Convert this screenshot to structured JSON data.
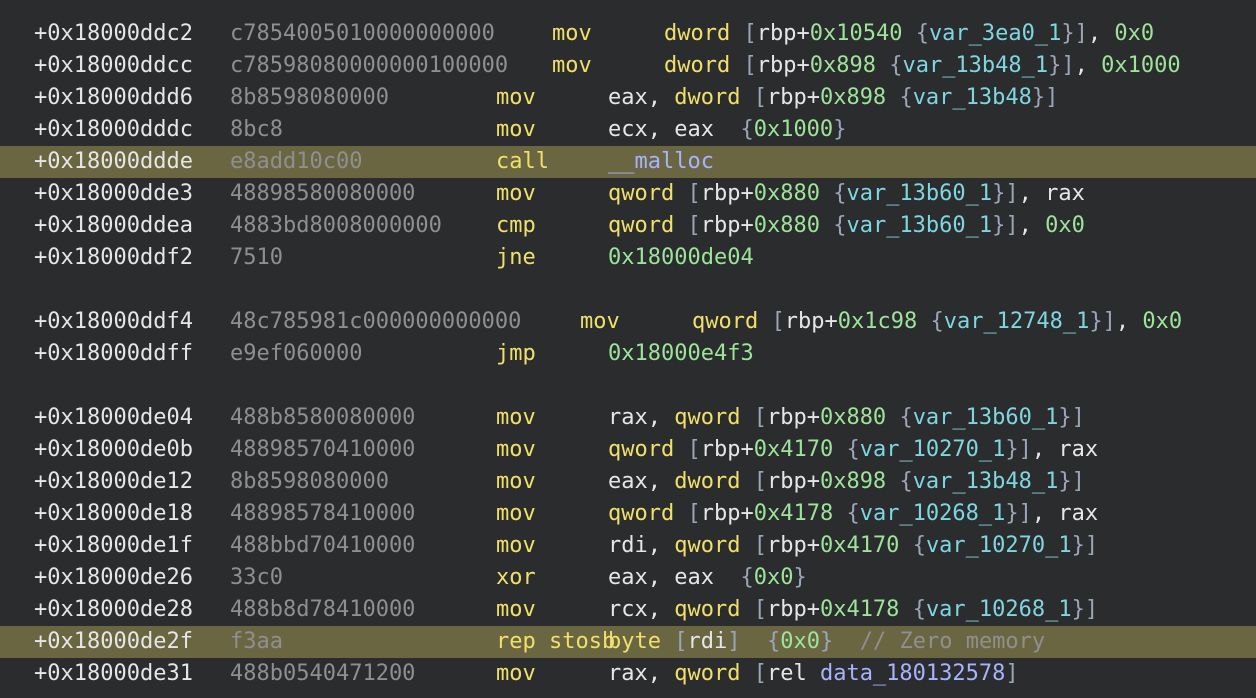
{
  "listing": {
    "rows": [
      {
        "addr": "+0x18000ddc2",
        "bytes": "c7854005010000000000",
        "mn": "mov",
        "ops": [
          [
            "kw",
            "dword "
          ],
          [
            "br",
            "["
          ],
          [
            "t",
            "rbp+"
          ],
          [
            "num",
            "0x10540"
          ],
          [
            "t",
            " "
          ],
          [
            "br",
            "{"
          ],
          [
            "var",
            "var_3ea0_1"
          ],
          [
            "br",
            "}"
          ],
          [
            "br",
            "]"
          ],
          [
            "t",
            ", "
          ],
          [
            "num",
            "0x0"
          ]
        ],
        "hl": false,
        "layout": "a"
      },
      {
        "addr": "+0x18000ddcc",
        "bytes": "c78598080000000100000",
        "mn": "mov",
        "ops": [
          [
            "kw",
            "dword "
          ],
          [
            "br",
            "["
          ],
          [
            "t",
            "rbp+"
          ],
          [
            "num",
            "0x898"
          ],
          [
            "t",
            " "
          ],
          [
            "br",
            "{"
          ],
          [
            "var",
            "var_13b48_1"
          ],
          [
            "br",
            "}"
          ],
          [
            "br",
            "]"
          ],
          [
            "t",
            ", "
          ],
          [
            "num",
            "0x1000"
          ]
        ],
        "hl": false,
        "layout": "a"
      },
      {
        "addr": "+0x18000ddd6",
        "bytes": "8b8598080000",
        "mn": "mov",
        "ops": [
          [
            "t",
            "eax, "
          ],
          [
            "kw",
            "dword "
          ],
          [
            "br",
            "["
          ],
          [
            "t",
            "rbp+"
          ],
          [
            "num",
            "0x898"
          ],
          [
            "t",
            " "
          ],
          [
            "br",
            "{"
          ],
          [
            "var",
            "var_13b48"
          ],
          [
            "br",
            "}"
          ],
          [
            "br",
            "]"
          ]
        ],
        "hl": false,
        "layout": "b"
      },
      {
        "addr": "+0x18000dddc",
        "bytes": "8bc8",
        "mn": "mov",
        "ops": [
          [
            "t",
            "ecx, eax  "
          ],
          [
            "br",
            "{"
          ],
          [
            "num",
            "0x1000"
          ],
          [
            "br",
            "}"
          ]
        ],
        "hl": false,
        "layout": "b"
      },
      {
        "addr": "+0x18000ddde",
        "bytes": "e8add10c00",
        "mn": "call",
        "ops": [
          [
            "sym",
            "__malloc"
          ]
        ],
        "hl": true,
        "layout": "b"
      },
      {
        "addr": "+0x18000dde3",
        "bytes": "48898580080000",
        "mn": "mov",
        "ops": [
          [
            "kw",
            "qword "
          ],
          [
            "br",
            "["
          ],
          [
            "t",
            "rbp+"
          ],
          [
            "num",
            "0x880"
          ],
          [
            "t",
            " "
          ],
          [
            "br",
            "{"
          ],
          [
            "var",
            "var_13b60_1"
          ],
          [
            "br",
            "}"
          ],
          [
            "br",
            "]"
          ],
          [
            "t",
            ", rax"
          ]
        ],
        "hl": false,
        "layout": "b"
      },
      {
        "addr": "+0x18000ddea",
        "bytes": "4883bd8008000000",
        "mn": "cmp",
        "ops": [
          [
            "kw",
            "qword "
          ],
          [
            "br",
            "["
          ],
          [
            "t",
            "rbp+"
          ],
          [
            "num",
            "0x880"
          ],
          [
            "t",
            " "
          ],
          [
            "br",
            "{"
          ],
          [
            "var",
            "var_13b60_1"
          ],
          [
            "br",
            "}"
          ],
          [
            "br",
            "]"
          ],
          [
            "t",
            ", "
          ],
          [
            "num",
            "0x0"
          ]
        ],
        "hl": false,
        "layout": "b"
      },
      {
        "addr": "+0x18000ddf2",
        "bytes": "7510",
        "mn": "jne",
        "ops": [
          [
            "num",
            "0x18000de04"
          ]
        ],
        "hl": false,
        "layout": "b"
      },
      {
        "addr": "+0x18000ddf4",
        "bytes": "48c785981c000000000000",
        "mn": "mov",
        "ops": [
          [
            "kw",
            "qword "
          ],
          [
            "br",
            "["
          ],
          [
            "t",
            "rbp+"
          ],
          [
            "num",
            "0x1c98"
          ],
          [
            "t",
            " "
          ],
          [
            "br",
            "{"
          ],
          [
            "var",
            "var_12748_1"
          ],
          [
            "br",
            "}"
          ],
          [
            "br",
            "]"
          ],
          [
            "t",
            ", "
          ],
          [
            "num",
            "0x0"
          ]
        ],
        "hl": false,
        "layout": "c"
      },
      {
        "addr": "+0x18000ddff",
        "bytes": "e9ef060000",
        "mn": "jmp",
        "ops": [
          [
            "num",
            "0x18000e4f3"
          ]
        ],
        "hl": false,
        "layout": "b"
      },
      {
        "addr": "+0x18000de04",
        "bytes": "488b8580080000",
        "mn": "mov",
        "ops": [
          [
            "t",
            "rax, "
          ],
          [
            "kw",
            "qword "
          ],
          [
            "br",
            "["
          ],
          [
            "t",
            "rbp+"
          ],
          [
            "num",
            "0x880"
          ],
          [
            "t",
            " "
          ],
          [
            "br",
            "{"
          ],
          [
            "var",
            "var_13b60_1"
          ],
          [
            "br",
            "}"
          ],
          [
            "br",
            "]"
          ]
        ],
        "hl": false,
        "layout": "b"
      },
      {
        "addr": "+0x18000de0b",
        "bytes": "48898570410000",
        "mn": "mov",
        "ops": [
          [
            "kw",
            "qword "
          ],
          [
            "br",
            "["
          ],
          [
            "t",
            "rbp+"
          ],
          [
            "num",
            "0x4170"
          ],
          [
            "t",
            " "
          ],
          [
            "br",
            "{"
          ],
          [
            "var",
            "var_10270_1"
          ],
          [
            "br",
            "}"
          ],
          [
            "br",
            "]"
          ],
          [
            "t",
            ", rax"
          ]
        ],
        "hl": false,
        "layout": "b"
      },
      {
        "addr": "+0x18000de12",
        "bytes": "8b8598080000",
        "mn": "mov",
        "ops": [
          [
            "t",
            "eax, "
          ],
          [
            "kw",
            "dword "
          ],
          [
            "br",
            "["
          ],
          [
            "t",
            "rbp+"
          ],
          [
            "num",
            "0x898"
          ],
          [
            "t",
            " "
          ],
          [
            "br",
            "{"
          ],
          [
            "var",
            "var_13b48_1"
          ],
          [
            "br",
            "}"
          ],
          [
            "br",
            "]"
          ]
        ],
        "hl": false,
        "layout": "b"
      },
      {
        "addr": "+0x18000de18",
        "bytes": "48898578410000",
        "mn": "mov",
        "ops": [
          [
            "kw",
            "qword "
          ],
          [
            "br",
            "["
          ],
          [
            "t",
            "rbp+"
          ],
          [
            "num",
            "0x4178"
          ],
          [
            "t",
            " "
          ],
          [
            "br",
            "{"
          ],
          [
            "var",
            "var_10268_1"
          ],
          [
            "br",
            "}"
          ],
          [
            "br",
            "]"
          ],
          [
            "t",
            ", rax"
          ]
        ],
        "hl": false,
        "layout": "b"
      },
      {
        "addr": "+0x18000de1f",
        "bytes": "488bbd70410000",
        "mn": "mov",
        "ops": [
          [
            "t",
            "rdi, "
          ],
          [
            "kw",
            "qword "
          ],
          [
            "br",
            "["
          ],
          [
            "t",
            "rbp+"
          ],
          [
            "num",
            "0x4170"
          ],
          [
            "t",
            " "
          ],
          [
            "br",
            "{"
          ],
          [
            "var",
            "var_10270_1"
          ],
          [
            "br",
            "}"
          ],
          [
            "br",
            "]"
          ]
        ],
        "hl": false,
        "layout": "b"
      },
      {
        "addr": "+0x18000de26",
        "bytes": "33c0",
        "mn": "xor",
        "ops": [
          [
            "t",
            "eax, eax  "
          ],
          [
            "br",
            "{"
          ],
          [
            "num",
            "0x0"
          ],
          [
            "br",
            "}"
          ]
        ],
        "hl": false,
        "layout": "b"
      },
      {
        "addr": "+0x18000de28",
        "bytes": "488b8d78410000",
        "mn": "mov",
        "ops": [
          [
            "t",
            "rcx, "
          ],
          [
            "kw",
            "qword "
          ],
          [
            "br",
            "["
          ],
          [
            "t",
            "rbp+"
          ],
          [
            "num",
            "0x4178"
          ],
          [
            "t",
            " "
          ],
          [
            "br",
            "{"
          ],
          [
            "var",
            "var_10268_1"
          ],
          [
            "br",
            "}"
          ],
          [
            "br",
            "]"
          ]
        ],
        "hl": false,
        "layout": "b"
      },
      {
        "addr": "+0x18000de2f",
        "bytes": "f3aa",
        "mn": "rep stosb",
        "ops": [
          [
            "kw",
            "byte "
          ],
          [
            "br",
            "["
          ],
          [
            "t",
            "rdi"
          ],
          [
            "br",
            "]"
          ],
          [
            "t",
            "  "
          ],
          [
            "br",
            "{"
          ],
          [
            "num",
            "0x0"
          ],
          [
            "br",
            "}"
          ],
          [
            "t",
            "  "
          ],
          [
            "cmt",
            "// Zero memory"
          ]
        ],
        "hl": true,
        "layout": "b"
      },
      {
        "addr": "+0x18000de31",
        "bytes": "488b0540471200",
        "mn": "mov",
        "ops": [
          [
            "t",
            "rax, "
          ],
          [
            "kw",
            "qword "
          ],
          [
            "br",
            "["
          ],
          [
            "t",
            "rel "
          ],
          [
            "data",
            "data_180132578"
          ],
          [
            "br",
            "]"
          ]
        ],
        "hl": false,
        "layout": "b"
      }
    ]
  }
}
